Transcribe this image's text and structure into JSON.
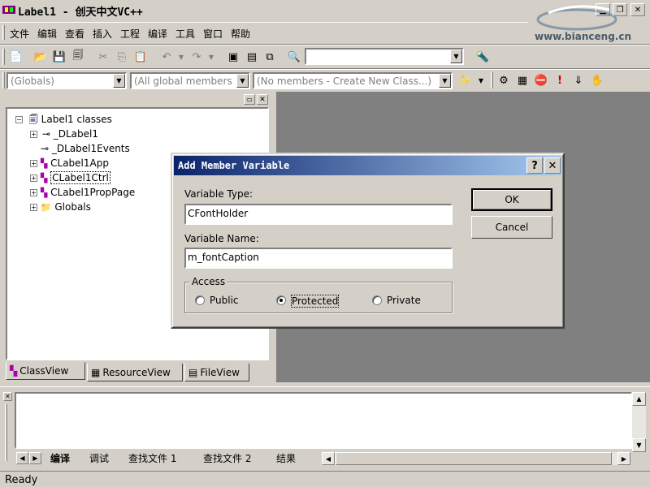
{
  "window": {
    "title": "Label1 - 创天中文VC++"
  },
  "watermark": {
    "site": "www.bianceng.cn"
  },
  "menu": [
    "文件",
    "编辑",
    "查看",
    "插入",
    "工程",
    "编译",
    "工具",
    "窗口",
    "帮助"
  ],
  "wizardbar": {
    "class_combo": "(Globals)",
    "filter_combo": "(All global members",
    "members_combo": "(No members - Create New Class...)"
  },
  "workspace": {
    "root": "Label1 classes",
    "items": [
      "_DLabel1",
      "_DLabel1Events",
      "CLabel1App",
      "CLabel1Ctrl",
      "CLabel1PropPage",
      "Globals"
    ],
    "tabs": [
      "ClassView",
      "ResourceView",
      "FileView"
    ]
  },
  "dialog": {
    "title": "Add Member Variable",
    "type_label": "Variable Type:",
    "type_value": "CFontHolder",
    "name_label": "Variable Name:",
    "name_value": "m_fontCaption",
    "access_label": "Access",
    "access_options": [
      "Public",
      "Protected",
      "Private"
    ],
    "access_selected": "Protected",
    "ok": "OK",
    "cancel": "Cancel",
    "help": "?",
    "close": "✕"
  },
  "output": {
    "tabs": [
      "编译",
      "调试",
      "查找文件 1",
      "查找文件 2",
      "结果"
    ]
  },
  "status": {
    "text": "Ready"
  }
}
